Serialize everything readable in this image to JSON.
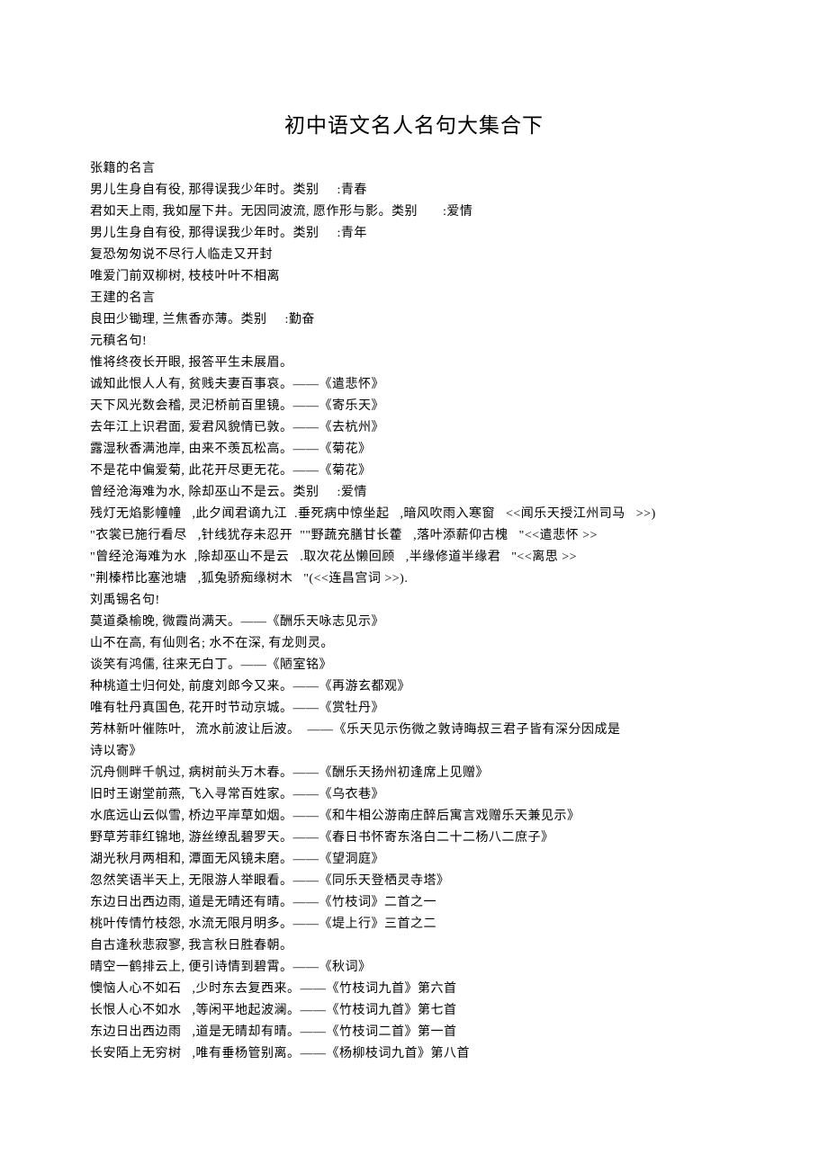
{
  "title": "初中语文名人名句大集合下",
  "lines": [
    "张籍的名言",
    "男儿生身自有役, 那得误我少年时。类别     :青春",
    "君如天上雨, 我如屋下井。无因同波流, 愿作形与影。类别       :爱情",
    "男儿生身自有役, 那得误我少年时。类别     :青年",
    "复恐匆匆说不尽行人临走又开封",
    "唯爱门前双柳树, 枝枝叶叶不相离",
    "王建的名言",
    "良田少锄理, 兰焦香亦薄。类别     :勤奋",
    "元稹名句!",
    "惟将终夜长开眼, 报答平生未展眉。",
    "诚知此恨人人有, 贫贱夫妻百事哀。——《遣悲怀》",
    "天下风光数会稽, 灵汜桥前百里镜。——《寄乐天》",
    "去年江上识君面, 爱君风貌情已敦。——《去杭州》",
    "露湿秋香满池岸, 由来不羡瓦松高。——《菊花》",
    "不是花中偏爱菊, 此花开尽更无花。——《菊花》",
    "曾经沧海难为水, 除却巫山不是云。类别     :爱情",
    "残灯无焰影幢幢   ,此夕闻君谪九江  .垂死病中惊坐起   ,暗风吹雨入寒窗   <<闻乐天授江州司马   >>)",
    "\"衣裳已施行看尽   ,针线犹存未忍开  \"\"野蔬充膳甘长藿   ,落叶添薪仰古槐   \"<<遣悲怀 >>",
    "\"曾经沧海难为水  ,除却巫山不是云   .取次花丛懒回顾   ,半缘修道半缘君   \"<<离思 >>",
    "\"荆榛栉比塞池塘   ,狐兔骄痴缘树木   \"(<<连昌宫词 >>).",
    "刘禹锡名句!",
    "莫道桑榆晚, 微霞尚满天。——《酬乐天咏志见示》",
    "山不在高, 有仙则名; 水不在深, 有龙则灵。",
    "谈笑有鸿儒, 往来无白丁。——《陋室铭》",
    "种桃道士归何处, 前度刘郎今又来。——《再游玄都观》",
    "唯有牡丹真国色, 花开时节动京城。——《赏牡丹》",
    "芳林新叶催陈叶,   流水前波让后波。  ——《乐天见示伤微之敦诗晦叔三君子皆有深分因成是",
    "诗以寄》",
    "沉舟侧畔千帆过, 病树前头万木春。——《酬乐天扬州初逢席上见赠》",
    "旧时王谢堂前燕, 飞入寻常百姓家。——《乌衣巷》",
    "水底远山云似雪, 桥边平岸草如烟。——《和牛相公游南庄醉后寓言戏赠乐天兼见示》",
    "野草芳菲红锦地, 游丝缭乱碧罗天。——《春日书怀寄东洛白二十二杨八二庶子》",
    "湖光秋月两相和, 潭面无风镜未磨。——《望洞庭》",
    "忽然笑语半天上, 无限游人举眼看。——《同乐天登栖灵寺塔》",
    "东边日出西边雨, 道是无晴还有晴。——《竹枝词》二首之一",
    "桃叶传情竹枝怨, 水流无限月明多。——《堤上行》三首之二",
    "自古逢秋悲寂寥, 我言秋日胜春朝。",
    "晴空一鹤排云上, 便引诗情到碧霄。——《秋词》",
    "懊恼人心不如石   ,少时东去复西来。——《竹枝词九首》第六首",
    "长恨人心不如水   ,等闲平地起波澜。——《竹枝词九首》第七首",
    "东边日出西边雨   ,道是无晴却有晴。——《竹枝词二首》第一首",
    "长安陌上无穷树   ,唯有垂杨管别离。——《杨柳枝词九首》第八首"
  ]
}
